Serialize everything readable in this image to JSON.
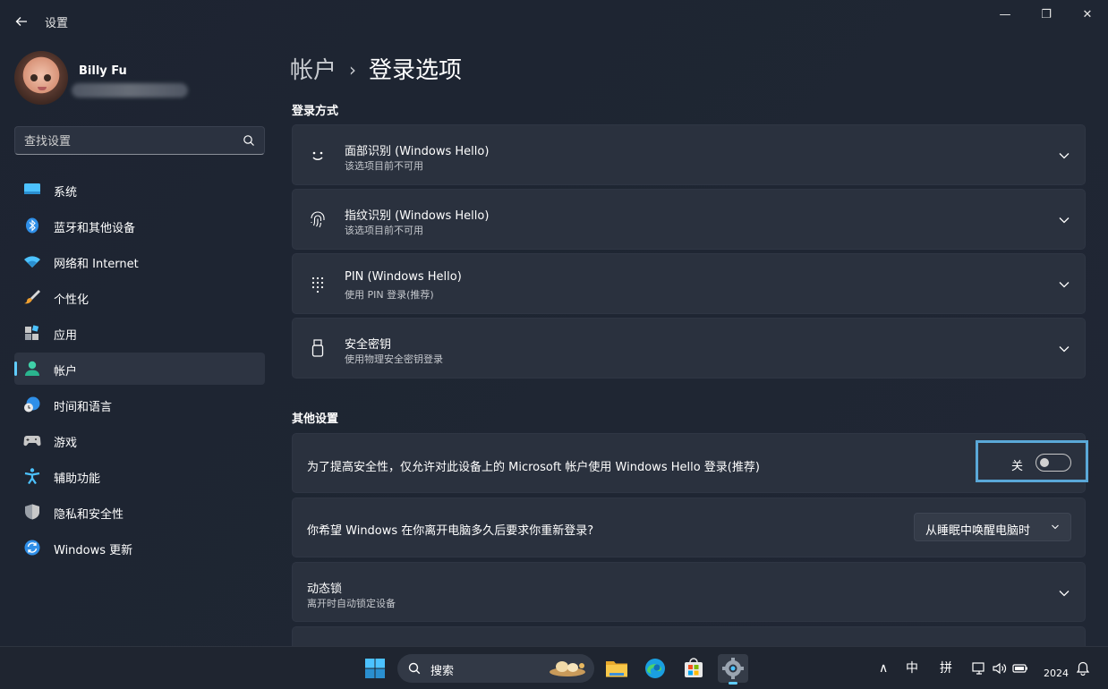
{
  "titlebar": {
    "app_title": "设置",
    "minimize": "—",
    "maximize": "❐",
    "close": "✕"
  },
  "profile": {
    "name": "Billy Fu"
  },
  "search": {
    "placeholder": "查找设置"
  },
  "nav": {
    "items": [
      {
        "label": "系统",
        "icon": "system-icon"
      },
      {
        "label": "蓝牙和其他设备",
        "icon": "bluetooth-icon"
      },
      {
        "label": "网络和 Internet",
        "icon": "wifi-icon"
      },
      {
        "label": "个性化",
        "icon": "brush-icon"
      },
      {
        "label": "应用",
        "icon": "apps-icon"
      },
      {
        "label": "帐户",
        "icon": "account-icon",
        "active": true
      },
      {
        "label": "时间和语言",
        "icon": "globe-clock-icon"
      },
      {
        "label": "游戏",
        "icon": "gamepad-icon"
      },
      {
        "label": "辅助功能",
        "icon": "accessibility-icon"
      },
      {
        "label": "隐私和安全性",
        "icon": "shield-icon"
      },
      {
        "label": "Windows 更新",
        "icon": "update-icon"
      }
    ]
  },
  "main": {
    "breadcrumb_parent": "帐户",
    "breadcrumb_sep": "›",
    "breadcrumb_current": "登录选项",
    "signin_section_title": "登录方式",
    "signin_methods": [
      {
        "title": "面部识别 (Windows Hello)",
        "subtitle": "该选项目前不可用",
        "icon": "face-icon"
      },
      {
        "title": "指纹识别 (Windows Hello)",
        "subtitle": "该选项目前不可用",
        "icon": "fingerprint-icon"
      },
      {
        "title": "PIN (Windows Hello)",
        "subtitle": "使用 PIN 登录(推荐)",
        "icon": "keypad-icon"
      },
      {
        "title": "安全密钥",
        "subtitle": "使用物理安全密钥登录",
        "icon": "usb-key-icon"
      }
    ],
    "other_section_title": "其他设置",
    "hello_only": {
      "text": "为了提高安全性，仅允许对此设备上的 Microsoft 帐户使用 Windows Hello 登录(推荐)",
      "toggle_label": "关",
      "toggle_on": false
    },
    "require_signin": {
      "text": "你希望 Windows 在你离开电脑多久后要求你重新登录?",
      "selected": "从睡眠中唤醒电脑时"
    },
    "dynamic_lock": {
      "title": "动态锁",
      "subtitle": "离开时自动锁定设备"
    }
  },
  "taskbar": {
    "search_label": "搜索",
    "tray_ime_1": "中",
    "tray_ime_2": "拼",
    "tray_caret": "∧",
    "time": "2024"
  },
  "colors": {
    "accent": "#60cdff",
    "highlight_box": "#5aa8d8",
    "card_bg": "#2a313e",
    "window_bg": "#1d2431"
  }
}
